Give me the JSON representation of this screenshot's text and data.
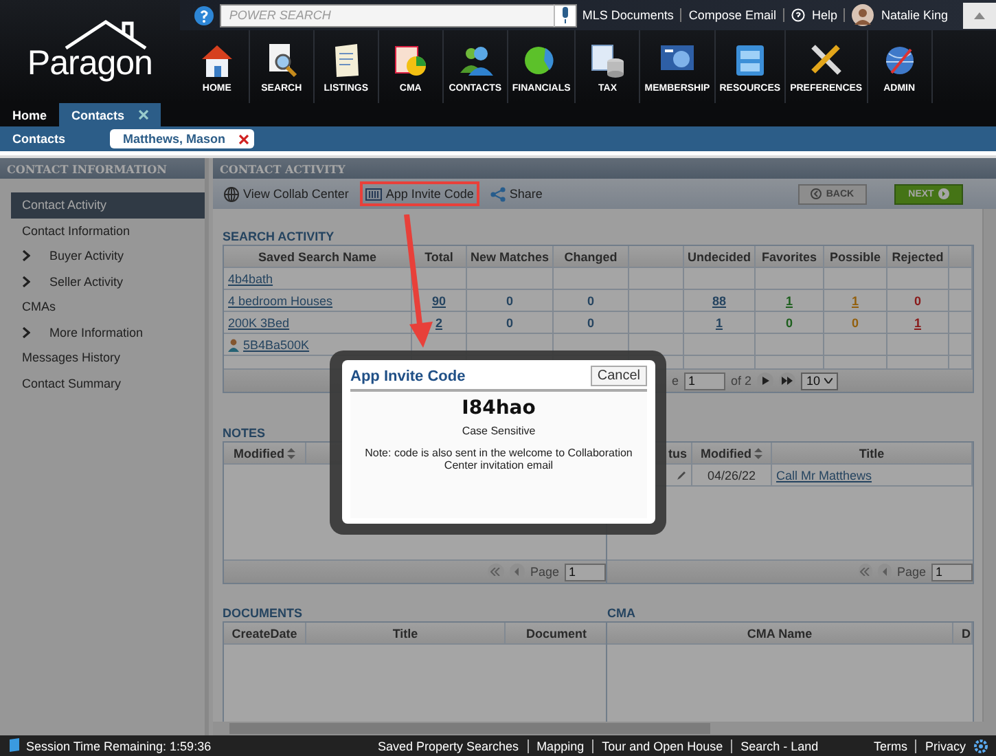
{
  "logo": "Paragon",
  "top_bar": {
    "search": {
      "placeholder": "POWER SEARCH"
    },
    "links": [
      "MLS Documents",
      "Compose Email"
    ],
    "help": "Help",
    "user": "Natalie King"
  },
  "nav": [
    "HOME",
    "SEARCH",
    "LISTINGS",
    "CMA",
    "CONTACTS",
    "FINANCIALS",
    "TAX",
    "MEMBERSHIP",
    "RESOURCES",
    "PREFERENCES",
    "ADMIN"
  ],
  "tabs": [
    {
      "label": "Home",
      "selected": false,
      "closable": false
    },
    {
      "label": "Contacts",
      "selected": true,
      "closable": true
    }
  ],
  "breadcrumb": {
    "label": "Contacts",
    "record": "Matthews, Mason"
  },
  "sidebar": {
    "title": "CONTACT INFORMATION",
    "items": [
      {
        "label": "Contact Activity",
        "kind": "link",
        "selected": true
      },
      {
        "label": "Contact Information",
        "kind": "link",
        "selected": false
      },
      {
        "label": "Buyer Activity",
        "kind": "group",
        "selected": false
      },
      {
        "label": "Seller Activity",
        "kind": "group",
        "selected": false
      },
      {
        "label": "CMAs",
        "kind": "link",
        "selected": false
      },
      {
        "label": "More Information",
        "kind": "group",
        "selected": false
      },
      {
        "label": "Messages History",
        "kind": "link",
        "selected": false
      },
      {
        "label": "Contact Summary",
        "kind": "link",
        "selected": false
      }
    ]
  },
  "activity": {
    "title": "CONTACT ACTIVITY",
    "toolbar": [
      {
        "label": "View Collab Center",
        "highlighted": false
      },
      {
        "label": "App Invite Code",
        "highlighted": true
      },
      {
        "label": "Share",
        "highlighted": false
      }
    ],
    "back": {
      "label": "BACK",
      "disabled": true
    },
    "next": {
      "label": "NEXT",
      "disabled": false
    },
    "search_activity": {
      "title": "SEARCH ACTIVITY",
      "columns": [
        "Saved Search Name",
        "Total",
        "New Matches",
        "Changed",
        "",
        "Undecided",
        "Favorites",
        "Possible",
        "Rejected"
      ],
      "rows": [
        {
          "shared": false,
          "cells": [
            {
              "text": "4b4bath",
              "link": true
            }
          ]
        },
        {
          "shared": false,
          "cells": [
            {
              "text": "4 bedroom Houses",
              "link": true
            },
            {
              "text": "90",
              "link": true
            },
            {
              "text": "0",
              "link": false
            },
            {
              "text": "0",
              "link": false
            },
            {
              "text": ""
            },
            {
              "text": "88",
              "link": true
            },
            {
              "text": "1",
              "link": true
            },
            {
              "text": "1",
              "link": true
            },
            {
              "text": "0",
              "link": false
            }
          ]
        },
        {
          "shared": false,
          "cells": [
            {
              "text": "200K 3Bed",
              "link": true
            },
            {
              "text": "2",
              "link": true
            },
            {
              "text": "0",
              "link": false
            },
            {
              "text": "0",
              "link": false
            },
            {
              "text": ""
            },
            {
              "text": "1",
              "link": true
            },
            {
              "text": "0",
              "link": false
            },
            {
              "text": "0",
              "link": false
            },
            {
              "text": "1",
              "link": true
            }
          ]
        },
        {
          "shared": true,
          "cells": [
            {
              "text": "5B4Ba500K",
              "link": true
            }
          ]
        }
      ],
      "pager": {
        "label": "e",
        "page": "1",
        "of": "of 2",
        "per_page": "10"
      }
    },
    "notes": {
      "title": "NOTES",
      "left_columns": [
        "Modified"
      ],
      "right_columns": [
        "tus",
        "Modified",
        "Title"
      ],
      "rows": [
        {
          "date": "04/26/22",
          "title": "Call Mr Matthews"
        }
      ],
      "pagers": [
        {
          "label": "Page",
          "page": "1"
        },
        {
          "label": "Page",
          "page": "1"
        }
      ]
    },
    "documents": {
      "title": "DOCUMENTS",
      "columns": [
        "CreateDate",
        "Title",
        "Document"
      ]
    },
    "cma": {
      "title": "CMA",
      "columns": [
        "CMA Name",
        "D"
      ]
    }
  },
  "dialog": {
    "title": "App Invite Code",
    "cancel": "Cancel",
    "code": "I84hao",
    "hint": "Case Sensitive",
    "note": "Note: code is also sent in the welcome to Collaboration Center invitation email"
  },
  "footer": {
    "session": "Session Time Remaining: 1:59:36",
    "links": [
      "Saved Property Searches",
      "Mapping",
      "Tour and Open House",
      "Search - Land"
    ],
    "right_links": [
      "Terms",
      "Privacy"
    ]
  }
}
